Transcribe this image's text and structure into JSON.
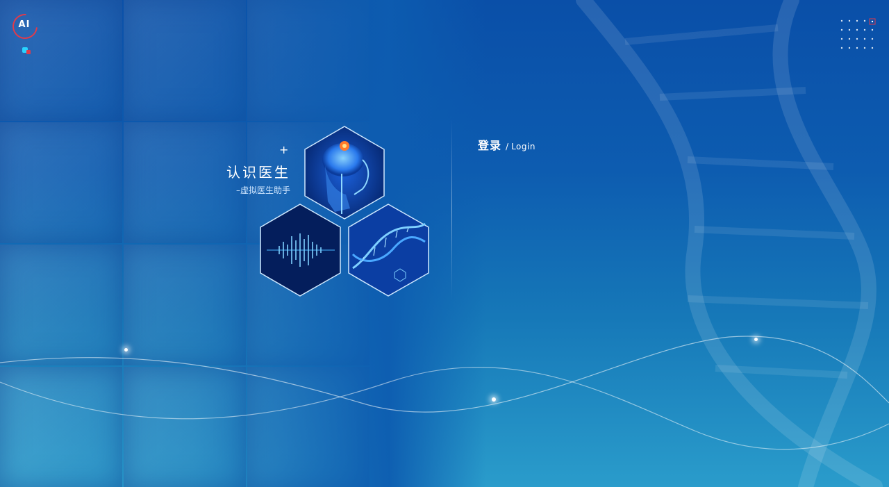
{
  "logo": {
    "text": "AI",
    "ring_color": "#e23a4a",
    "accent_cyan": "#28d3ff",
    "accent_red": "#e23a4a"
  },
  "decor": {
    "dots_icon": "dot-grid-icon",
    "hero_icons": [
      "brain-scan-hexagon",
      "sound-wave-hexagon",
      "dna-hexagon"
    ],
    "background_primary": "#0a4fa8",
    "background_secondary": "#2a9ccb"
  },
  "brand": {
    "plus": "+",
    "title": "认识医生",
    "subtitle": "–虚拟医生助手"
  },
  "login": {
    "title_cn": "登录",
    "separator": "/",
    "title_en": "Login"
  }
}
